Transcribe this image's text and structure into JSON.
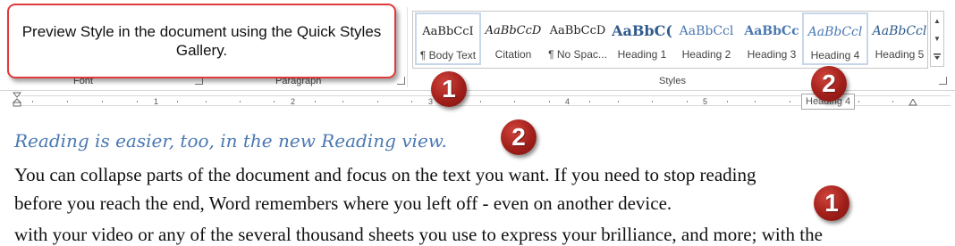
{
  "callout": {
    "text": "Preview Style in the document using the Quick Styles Gallery."
  },
  "ribbon": {
    "groups": {
      "font": "Font",
      "paragraph": "Paragraph",
      "styles": "Styles"
    }
  },
  "styles_gallery": {
    "tiles": [
      {
        "sample": "AaBbCcI",
        "name": "¶ Body Text"
      },
      {
        "sample": "AaBbCcD",
        "name": "Citation"
      },
      {
        "sample": "AaBbCcD",
        "name": "¶ No Spac..."
      },
      {
        "sample": "AaBbC(",
        "name": "Heading 1"
      },
      {
        "sample": "AaBbCcl",
        "name": "Heading 2"
      },
      {
        "sample": "AaBbCc",
        "name": "Heading 3"
      },
      {
        "sample": "AaBbCcl",
        "name": "Heading 4"
      },
      {
        "sample": "AaBbCcl",
        "name": "Heading 5"
      }
    ],
    "selected_index": 0,
    "hover_index": 6,
    "scroll_icons": [
      "scroll-up-icon",
      "scroll-down-icon",
      "more-icon"
    ]
  },
  "ruler": {
    "numbers": [
      "1",
      "2",
      "3",
      "4",
      "5"
    ]
  },
  "tooltip": {
    "text": "Heading 4"
  },
  "badges": {
    "one": "1",
    "two": "2"
  },
  "document": {
    "heading": "Reading is easier, too, in the new Reading view.",
    "body_lines": [
      "You can collapse parts of the document and focus on the text you want. If you need to stop reading",
      "before you reach the end, Word remembers where you left off - even on another device."
    ],
    "cut_line": "with your video or any of the several thousand sheets you use to express your brilliance, and more; with the"
  },
  "colors": {
    "callout_border": "#e03a3a",
    "badge_red": "#a11f1a",
    "heading_blue": "#4a78b2",
    "gallery_selected": "#c8d6ea"
  }
}
